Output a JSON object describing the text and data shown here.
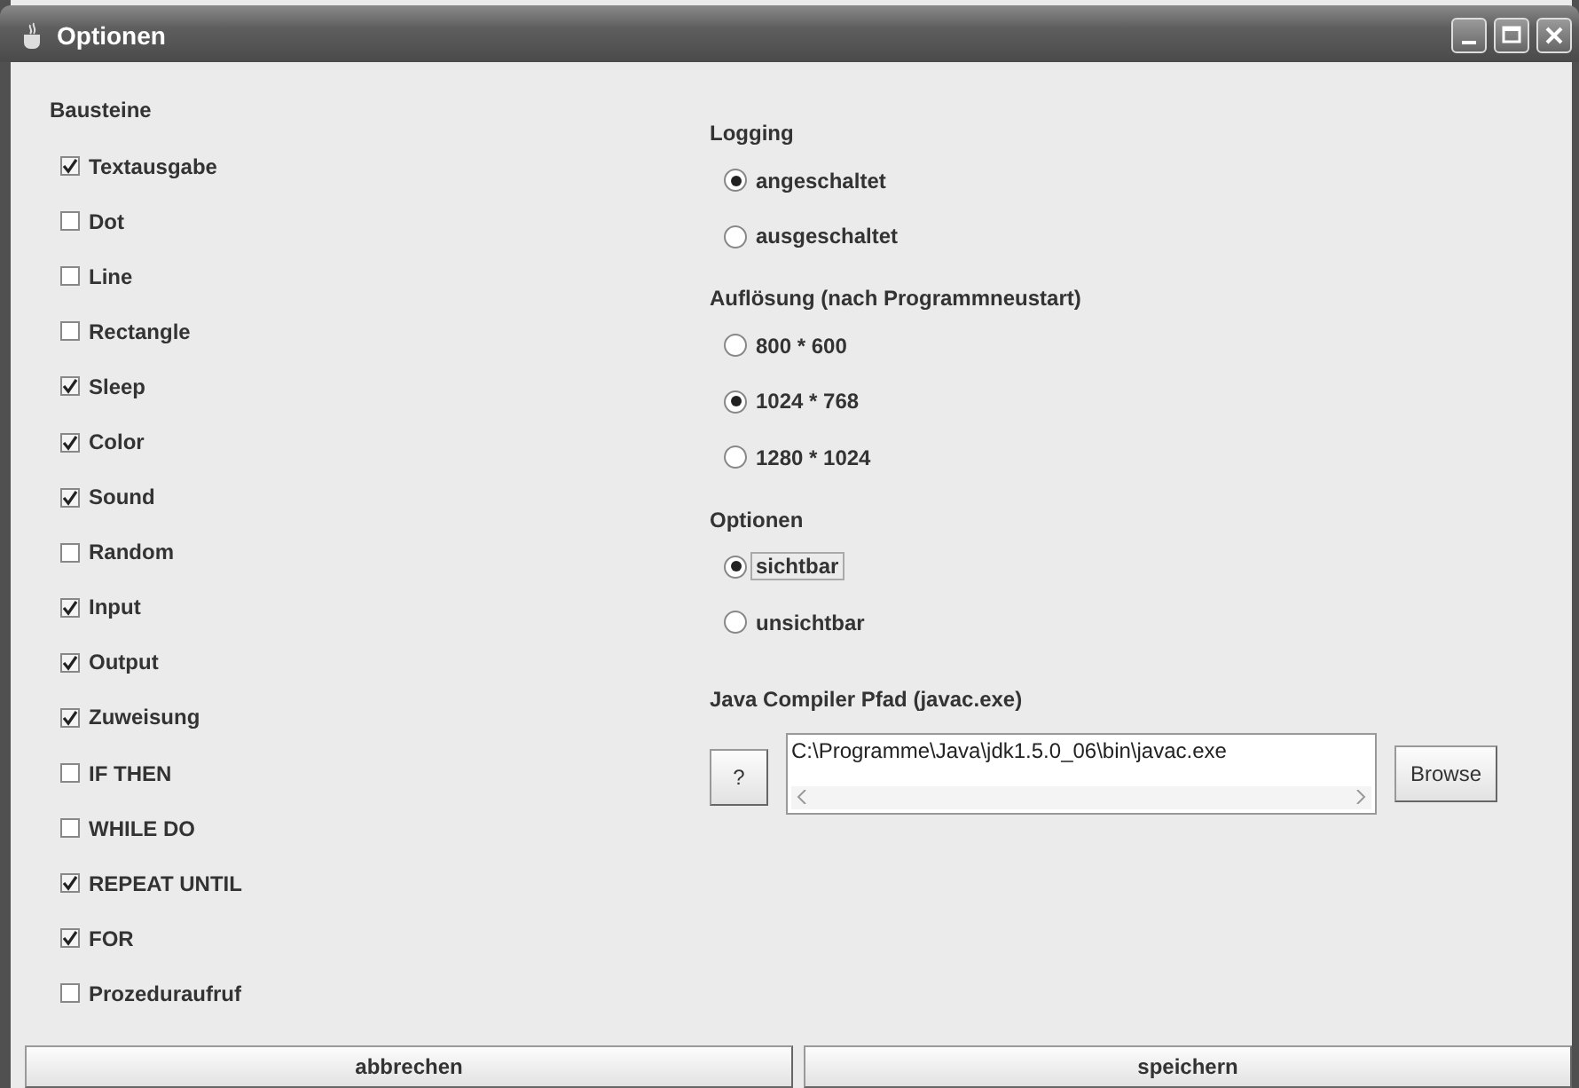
{
  "window": {
    "title": "Optionen"
  },
  "bausteine": {
    "title": "Bausteine",
    "items": [
      {
        "label": "Textausgabe",
        "checked": true
      },
      {
        "label": "Dot",
        "checked": false
      },
      {
        "label": "Line",
        "checked": false
      },
      {
        "label": "Rectangle",
        "checked": false
      },
      {
        "label": "Sleep",
        "checked": true
      },
      {
        "label": "Color",
        "checked": true
      },
      {
        "label": "Sound",
        "checked": true
      },
      {
        "label": "Random",
        "checked": false
      },
      {
        "label": "Input",
        "checked": true
      },
      {
        "label": "Output",
        "checked": true
      },
      {
        "label": "Zuweisung",
        "checked": true
      },
      {
        "label": "IF THEN",
        "checked": false
      },
      {
        "label": "WHILE DO",
        "checked": false
      },
      {
        "label": "REPEAT UNTIL",
        "checked": true
      },
      {
        "label": "FOR",
        "checked": true
      },
      {
        "label": "Prozeduraufruf",
        "checked": false
      }
    ]
  },
  "groups": [
    {
      "title": "Logging",
      "options": [
        {
          "label": "angeschaltet",
          "selected": true,
          "focused": false
        },
        {
          "label": "ausgeschaltet",
          "selected": false,
          "focused": false
        }
      ]
    },
    {
      "title": "Auflösung (nach Programmneustart)",
      "options": [
        {
          "label": "800 * 600",
          "selected": false,
          "focused": false
        },
        {
          "label": "1024 * 768",
          "selected": true,
          "focused": false
        },
        {
          "label": "1280 * 1024",
          "selected": false,
          "focused": false
        }
      ]
    },
    {
      "title": "Optionen",
      "options": [
        {
          "label": "sichtbar",
          "selected": true,
          "focused": true
        },
        {
          "label": "unsichtbar",
          "selected": false,
          "focused": false
        }
      ]
    }
  ],
  "compiler": {
    "title": "Java Compiler Pfad (javac.exe)",
    "help_button": "?",
    "path": "C:\\Programme\\Java\\jdk1.5.0_06\\bin\\javac.exe",
    "browse_button": "Browse"
  },
  "buttons": [
    "abbrechen",
    "speichern"
  ]
}
